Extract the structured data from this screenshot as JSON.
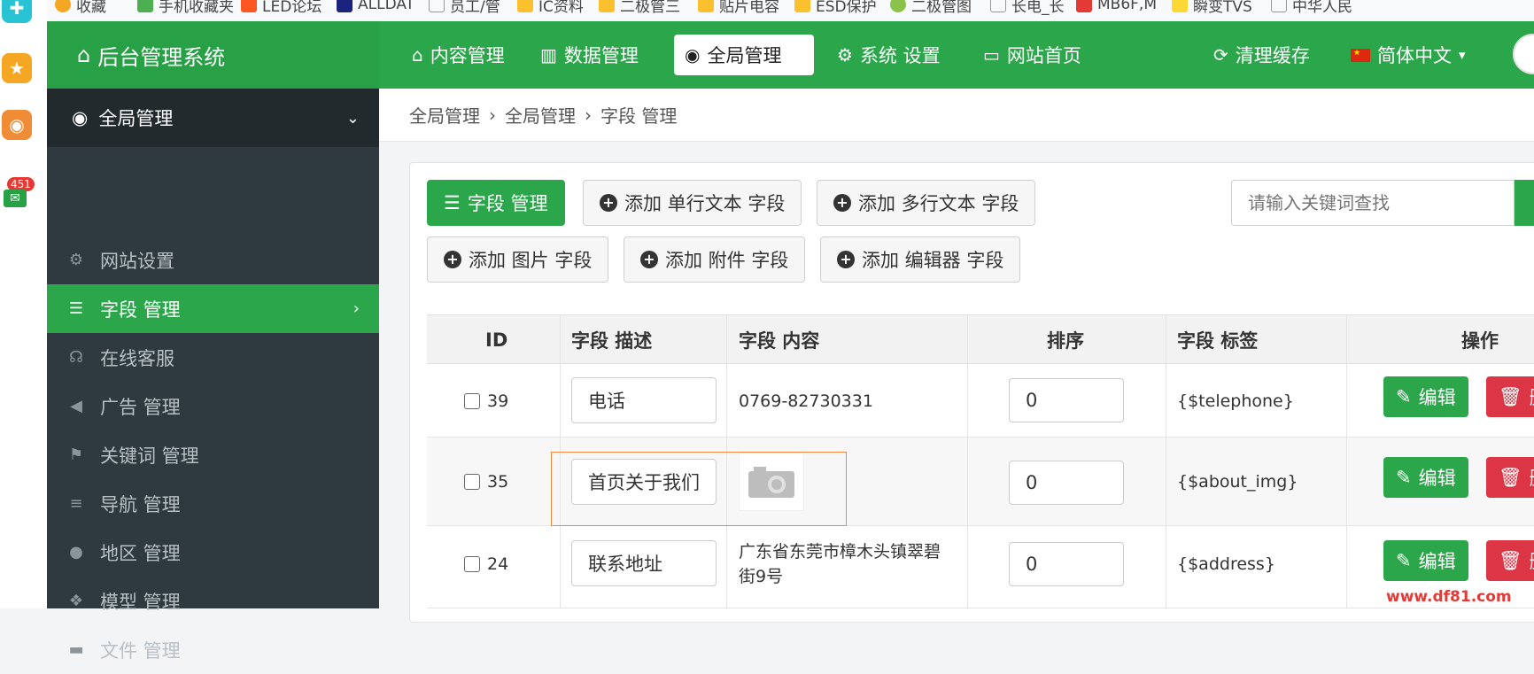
{
  "bookmarks": [
    {
      "label": "收藏",
      "color": "#f5a623"
    },
    {
      "label": "手机收藏夹",
      "color": "#4caf50"
    },
    {
      "label": "LED论坛",
      "color": "#ff5722"
    },
    {
      "label": "ALLDAT",
      "color": "#1a237e"
    },
    {
      "label": "员工/管",
      "color": "#9e9e9e"
    },
    {
      "label": "IC资料",
      "color": "#fbc02d"
    },
    {
      "label": "二极管三",
      "color": "#fbc02d"
    },
    {
      "label": "贴片电容",
      "color": "#fbc02d"
    },
    {
      "label": "ESD保护",
      "color": "#fbc02d"
    },
    {
      "label": "二极管图",
      "color": "#8bc34a"
    },
    {
      "label": "长电_长",
      "color": "#9e9e9e"
    },
    {
      "label": "MB6F,M",
      "color": "#e53935"
    },
    {
      "label": "瞬变TVS",
      "color": "#fdd835"
    },
    {
      "label": "中华人民",
      "color": "#9e9e9e"
    }
  ],
  "strip": {
    "mail_badge": "451"
  },
  "topnav": {
    "brand": "后台管理系统",
    "items": [
      {
        "label": "内容管理",
        "icon": "home-icon"
      },
      {
        "label": "数据管理",
        "icon": "bar-chart-icon"
      },
      {
        "label": "全局管理",
        "icon": "globe-icon"
      },
      {
        "label": "系统 设置",
        "icon": "gears-icon"
      },
      {
        "label": "网站首页",
        "icon": "monitor-icon"
      }
    ],
    "clear_cache": "清理缓存",
    "language": "简体中文"
  },
  "sidebar": {
    "header": "全局管理",
    "items": [
      {
        "label": "网站设置",
        "icon": "gear-icon"
      },
      {
        "label": "字段 管理",
        "icon": "list-icon"
      },
      {
        "label": "在线客服",
        "icon": "headset-icon"
      },
      {
        "label": "广告 管理",
        "icon": "megaphone-icon"
      },
      {
        "label": "关键词 管理",
        "icon": "flag-icon"
      },
      {
        "label": "导航 管理",
        "icon": "bars-icon"
      },
      {
        "label": "地区 管理",
        "icon": "map-marker-icon"
      },
      {
        "label": "模型 管理",
        "icon": "cubes-icon"
      },
      {
        "label": "文件 管理",
        "icon": "folder-icon"
      }
    ]
  },
  "breadcrumb": [
    "全局管理",
    "全局管理",
    "字段 管理"
  ],
  "toolbar": {
    "field_manage": "字段 管理",
    "add_single": "添加 单行文本 字段",
    "add_multi": "添加 多行文本 字段",
    "add_image": "添加 图片 字段",
    "add_attach": "添加 附件 字段",
    "add_editor": "添加 编辑器 字段",
    "search_placeholder": "请输入关键词查找"
  },
  "table": {
    "headers": [
      "ID",
      "字段 描述",
      "字段 内容",
      "排序",
      "字段 标签",
      "操作"
    ],
    "rows": [
      {
        "id": "39",
        "desc": "电话",
        "content": "0769-82730331",
        "order": "0",
        "tag": "{$telephone}"
      },
      {
        "id": "35",
        "desc": "首页关于我们",
        "content": "",
        "order": "0",
        "tag": "{$about_img}"
      },
      {
        "id": "24",
        "desc": "联系地址",
        "content": "广东省东莞市樟木头镇翠碧街9号",
        "order": "0",
        "tag": "{$address}"
      }
    ],
    "edit_label": "编辑",
    "delete_label": "删"
  },
  "watermark": "www.df81.com",
  "colors": {
    "primary": "#2ba64a",
    "danger": "#dc3545",
    "sidebar": "#2f3a40"
  }
}
